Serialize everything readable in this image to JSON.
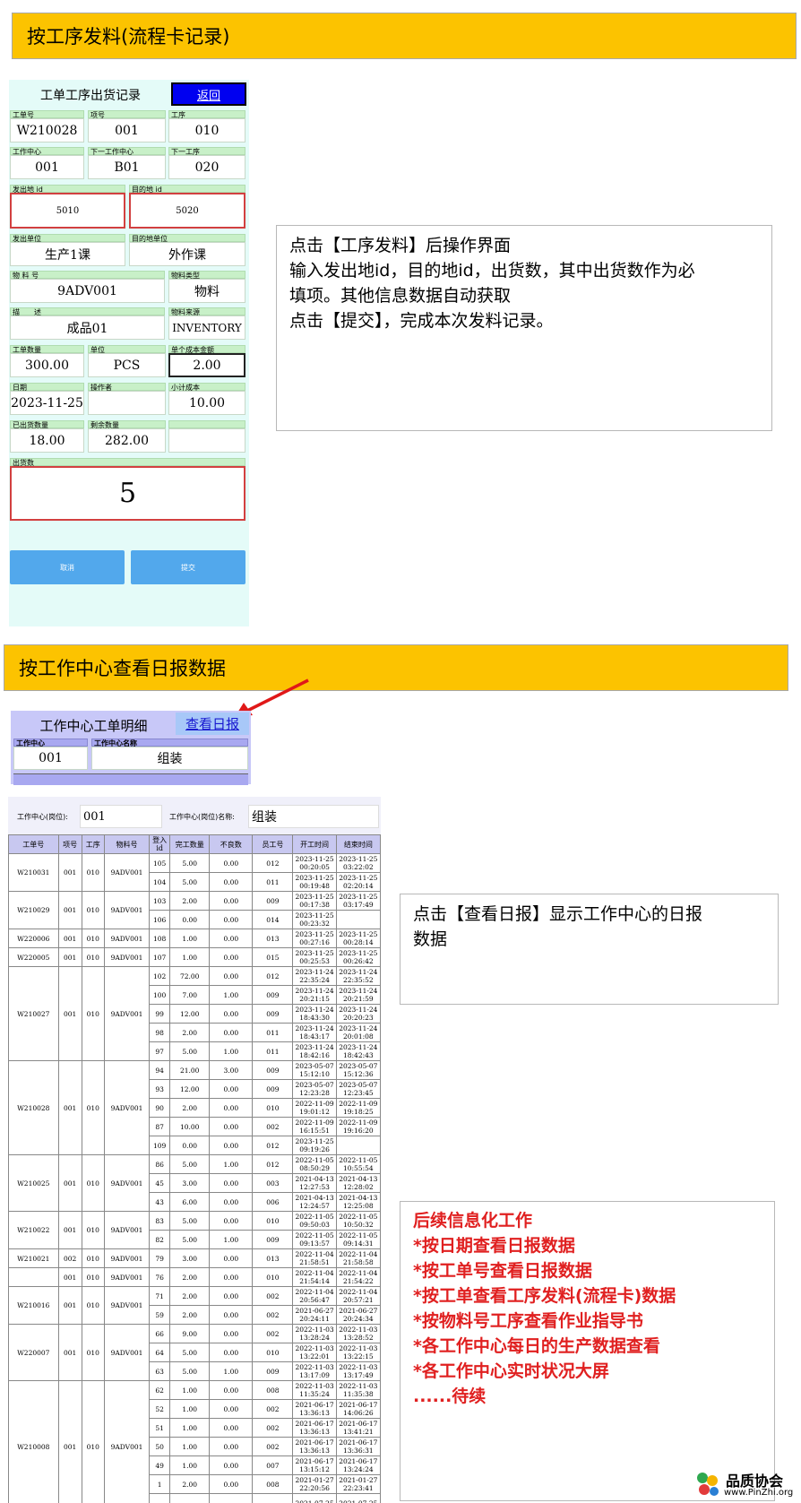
{
  "banner1": "按工序发料(流程卡记录)",
  "banner2": "按工作中心查看日报数据",
  "form1": {
    "title": "工单工序出货记录",
    "back": "返回",
    "fields": {
      "wo_label": "工单号",
      "wo": "W210028",
      "item_label": "项号",
      "item": "001",
      "op_label": "工序",
      "op": "010",
      "wc_label": "工作中心",
      "wc": "001",
      "nwc_label": "下一工作中心",
      "nwc": "B01",
      "nop_label": "下一工序",
      "nop": "020",
      "from_label": "发出地 id",
      "from": "5010",
      "to_label": "目的地 id",
      "to": "5020",
      "fromunit_label": "发出单位",
      "fromunit": "生产1课",
      "tounit_label": "目的地单位",
      "tounit": "外作课",
      "mat_label": "物 料 号",
      "mat": "9ADV001",
      "mattype_label": "物料类型",
      "mattype": "物料",
      "desc_label": "描　　述",
      "desc": "成品01",
      "matsrc_label": "物料来源",
      "matsrc": "INVENTORY",
      "qty_label": "工单数量",
      "qty": "300.00",
      "unit_label": "单位",
      "unit": "PCS",
      "cost_label": "单个成本金额",
      "cost": "2.00",
      "date_label": "日期",
      "date": "2023-11-25",
      "operator_label": "操作者",
      "operator": "",
      "subtotal_label": "小计成本",
      "subtotal": "10.00",
      "shipped_label": "已出货数量",
      "shipped": "18.00",
      "remain_label": "剩余数量",
      "remain": "282.00",
      "ship_label": "出货数",
      "ship": "5"
    },
    "cancel": "取消",
    "submit": "提交"
  },
  "note1": [
    "点击【工序发料】后操作界面",
    "输入发出地id，目的地id，出货数，其中出货数作为必",
    "填项。其他信息数据自动获取",
    "点击【提交】，完成本次发料记录。"
  ],
  "wc_panel": {
    "title": "工作中心工单明细",
    "link": "查看日报",
    "wc_label": "工作中心",
    "wc_value": "001",
    "name_label": "工作中心名称",
    "name_value": "组装"
  },
  "report": {
    "wc_label": "工作中心(岗位):",
    "wc_value": "001",
    "name_label": "工作中心(岗位)名称:",
    "name_value": "组装",
    "columns": [
      "工单号",
      "项号",
      "工序",
      "物料号",
      "登入id",
      "完工数量",
      "不良数",
      "员工号",
      "开工时间",
      "结束时间"
    ],
    "groups": [
      {
        "wo": "W210031",
        "item": "001",
        "op": "010",
        "mat": "9ADV001",
        "rows": [
          [
            "105",
            "5.00",
            "0.00",
            "012",
            "2023-11-25 00:20:05",
            "2023-11-25 03:22:02"
          ],
          [
            "104",
            "5.00",
            "0.00",
            "011",
            "2023-11-25 00:19:48",
            "2023-11-25 02:20:14"
          ]
        ]
      },
      {
        "wo": "W210029",
        "item": "001",
        "op": "010",
        "mat": "9ADV001",
        "rows": [
          [
            "103",
            "2.00",
            "0.00",
            "009",
            "2023-11-25 00:17:38",
            "2023-11-25 03:17:49"
          ],
          [
            "106",
            "0.00",
            "0.00",
            "014",
            "2023-11-25 00:23:32",
            ""
          ]
        ]
      },
      {
        "wo": "W220006",
        "item": "001",
        "op": "010",
        "mat": "9ADV001",
        "rows": [
          [
            "108",
            "1.00",
            "0.00",
            "013",
            "2023-11-25 00:27:16",
            "2023-11-25 00:28:14"
          ]
        ]
      },
      {
        "wo": "W220005",
        "item": "001",
        "op": "010",
        "mat": "9ADV001",
        "rows": [
          [
            "107",
            "1.00",
            "0.00",
            "015",
            "2023-11-25 00:25:53",
            "2023-11-25 00:26:42"
          ]
        ]
      },
      {
        "wo": "W210027",
        "item": "001",
        "op": "010",
        "mat": "9ADV001",
        "rows": [
          [
            "102",
            "72.00",
            "0.00",
            "012",
            "2023-11-24 22:35:24",
            "2023-11-24 22:35:52"
          ],
          [
            "100",
            "7.00",
            "1.00",
            "009",
            "2023-11-24 20:21:15",
            "2023-11-24 20:21:59"
          ],
          [
            "99",
            "12.00",
            "0.00",
            "009",
            "2023-11-24 18:43:30",
            "2023-11-24 20:20:23"
          ],
          [
            "98",
            "2.00",
            "0.00",
            "011",
            "2023-11-24 18:43:17",
            "2023-11-24 20:01:08"
          ],
          [
            "97",
            "5.00",
            "1.00",
            "011",
            "2023-11-24 18:42:16",
            "2023-11-24 18:42:43"
          ]
        ]
      },
      {
        "wo": "W210028",
        "item": "001",
        "op": "010",
        "mat": "9ADV001",
        "rows": [
          [
            "94",
            "21.00",
            "3.00",
            "009",
            "2023-05-07 15:12:10",
            "2023-05-07 15:12:36"
          ],
          [
            "93",
            "12.00",
            "0.00",
            "009",
            "2023-05-07 12:23:28",
            "2023-05-07 12:23:45"
          ],
          [
            "90",
            "2.00",
            "0.00",
            "010",
            "2022-11-09 19:01:12",
            "2022-11-09 19:18:25"
          ],
          [
            "87",
            "10.00",
            "0.00",
            "002",
            "2022-11-09 16:15:51",
            "2022-11-09 19:16:20"
          ],
          [
            "109",
            "0.00",
            "0.00",
            "012",
            "2023-11-25 09:19:26",
            ""
          ]
        ]
      },
      {
        "wo": "W210025",
        "item": "001",
        "op": "010",
        "mat": "9ADV001",
        "rows": [
          [
            "86",
            "5.00",
            "1.00",
            "012",
            "2022-11-05 08:50:29",
            "2022-11-05 10:55:54"
          ],
          [
            "45",
            "3.00",
            "0.00",
            "003",
            "2021-04-13 12:27:53",
            "2021-04-13 12:28:02"
          ],
          [
            "43",
            "6.00",
            "0.00",
            "006",
            "2021-04-13 12:24:57",
            "2021-04-13 12:25:08"
          ]
        ]
      },
      {
        "wo": "W210022",
        "item": "001",
        "op": "010",
        "mat": "9ADV001",
        "rows": [
          [
            "83",
            "5.00",
            "0.00",
            "010",
            "2022-11-05 09:50:03",
            "2022-11-05 10:50:32"
          ],
          [
            "82",
            "5.00",
            "1.00",
            "009",
            "2022-11-05 09:13:57",
            "2022-11-05 09:14:31"
          ]
        ]
      },
      {
        "wo": "W210021",
        "item": "002",
        "op": "010",
        "mat": "9ADV001",
        "rows": [
          [
            "79",
            "3.00",
            "0.00",
            "013",
            "2022-11-04 21:58:51",
            "2022-11-04 21:58:58"
          ]
        ]
      },
      {
        "wo": "",
        "item": "001",
        "op": "010",
        "mat": "9ADV001",
        "rows": [
          [
            "76",
            "2.00",
            "0.00",
            "010",
            "2022-11-04 21:54:14",
            "2022-11-04 21:54:22"
          ]
        ]
      },
      {
        "wo": "W210016",
        "item": "001",
        "op": "010",
        "mat": "9ADV001",
        "rows": [
          [
            "71",
            "2.00",
            "0.00",
            "002",
            "2022-11-04 20:56:47",
            "2022-11-04 20:57:21"
          ],
          [
            "59",
            "2.00",
            "0.00",
            "002",
            "2021-06-27 20:24:11",
            "2021-06-27 20:24:34"
          ]
        ]
      },
      {
        "wo": "W220007",
        "item": "001",
        "op": "010",
        "mat": "9ADV001",
        "rows": [
          [
            "66",
            "9.00",
            "0.00",
            "002",
            "2022-11-03 13:28:24",
            "2022-11-03 13:28:52"
          ],
          [
            "64",
            "5.00",
            "0.00",
            "010",
            "2022-11-03 13:22:01",
            "2022-11-03 13:22:15"
          ],
          [
            "63",
            "5.00",
            "1.00",
            "009",
            "2022-11-03 13:17:09",
            "2022-11-03 13:17:49"
          ]
        ]
      },
      {
        "wo": "W210008",
        "item": "001",
        "op": "010",
        "mat": "9ADV001",
        "rows": [
          [
            "62",
            "1.00",
            "0.00",
            "008",
            "2022-11-03 11:35:24",
            "2022-11-03 11:35:38"
          ],
          [
            "52",
            "1.00",
            "0.00",
            "002",
            "2021-06-17 13:36:13",
            "2021-06-17 14:06:26"
          ],
          [
            "51",
            "1.00",
            "0.00",
            "002",
            "2021-06-17 13:36:13",
            "2021-06-17 13:41:21"
          ],
          [
            "50",
            "1.00",
            "0.00",
            "002",
            "2021-06-17 13:36:13",
            "2021-06-17 13:36:31"
          ],
          [
            "49",
            "1.00",
            "0.00",
            "007",
            "2021-06-17 13:15:12",
            "2021-06-17 13:24:24"
          ],
          [
            "1",
            "2.00",
            "0.00",
            "008",
            "2021-01-27 22:20:56",
            "2021-01-27 22:23:41"
          ],
          [
            "",
            "",
            "",
            "",
            "2021-07-25",
            "2021-07-25"
          ]
        ]
      }
    ]
  },
  "note2": [
    "点击【查看日报】显示工作中心的日报",
    "数据"
  ],
  "note3": [
    "后续信息化工作",
    "*按日期查看日报数据",
    "*按工单号查看日报数据",
    "*按工单查看工序发料(流程卡)数据",
    "*按物料号工序查看作业指导书",
    "*各工作中心每日的生产数据查看",
    "*各工作中心实时状况大屏",
    "......待续"
  ],
  "watermark": {
    "name": "品质协会",
    "url": "www.PinZhi.org"
  },
  "colors": {
    "banner": "#fcc300",
    "accent_red": "#e02020",
    "link_blue": "#0000ee"
  }
}
